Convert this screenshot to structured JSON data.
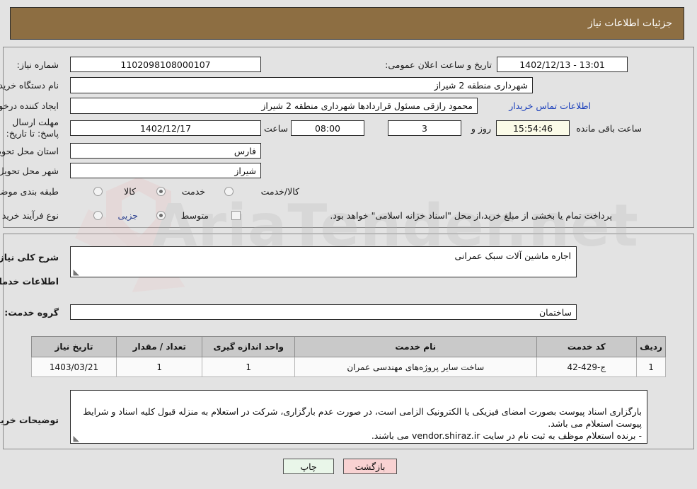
{
  "header": {
    "title": "جزئیات اطلاعات نیاز"
  },
  "colors": {
    "header_bg": "#8d6e42",
    "page_bg": "#e3e3e3",
    "link": "#1b3fbb",
    "timer_bg": "#fbfbe8",
    "table_header_bg": "#c9c9c9",
    "print_button_bg": "#e9f6e9",
    "back_button_bg": "#f8d2d2"
  },
  "form": {
    "need_number_label": "شماره نیاز:",
    "need_number_value": "1102098108000107",
    "buyer_org_label": "نام دستگاه خریدار:",
    "buyer_org_value": "شهرداری منطقه 2 شیراز",
    "requester_label": "ایجاد کننده درخواست:",
    "requester_value": "محمود رازقی مسئول قراردادها شهرداری منطقه 2 شیراز",
    "public_announce_label": "تاریخ و ساعت اعلان عمومی:",
    "public_announce_value": "13:01 - 1402/12/13",
    "buyer_contact_link": "اطلاعات تماس خریدار",
    "deadline_label": "مهلت ارسال پاسخ: تا تاریخ:",
    "deadline_date": "1402/12/17",
    "deadline_hour_label": "ساعت",
    "deadline_hour_value": "08:00",
    "days_value": "3",
    "days_unit_label": "روز و",
    "countdown_value": "15:54:46",
    "countdown_suffix_label": "ساعت باقی مانده",
    "province_label": "استان محل تحویل:",
    "province_value": "فارس",
    "city_label": "شهر محل تحویل:",
    "city_value": "شیراز",
    "category_label": "طبقه بندی موضوعی:",
    "category_options": [
      {
        "label": "کالا",
        "selected": false
      },
      {
        "label": "خدمت",
        "selected": true
      },
      {
        "label": "کالا/خدمت",
        "selected": false
      }
    ],
    "purchase_type_label": "نوع فرآیند خرید :",
    "purchase_type_options": [
      {
        "label": "جزیی",
        "selected": false
      },
      {
        "label": "متوسط",
        "selected": true
      }
    ],
    "treasury_checkbox_checked": false,
    "treasury_text": "پرداخت تمام یا بخشی از مبلغ خرید،از محل \"اسناد خزانه اسلامی\" خواهد بود."
  },
  "description": {
    "general_need_label": "شرح کلی نیاز:",
    "general_need_value": "اجاره ماشین آلات سبک عمرانی",
    "services_info_heading": "اطلاعات خدمات مورد نیاز",
    "service_group_label": "گروه خدمت:",
    "service_group_value": "ساختمان"
  },
  "table": {
    "columns": [
      "ردیف",
      "کد خدمت",
      "نام خدمت",
      "واحد اندازه گیری",
      "تعداد / مقدار",
      "تاریخ نیاز"
    ],
    "rows": [
      {
        "row": "1",
        "service_code": "ج-429-42",
        "service_name": "ساخت سایر پروژه‌های مهندسی عمران",
        "unit": "1",
        "quantity": "1",
        "need_date": "1403/03/21"
      }
    ]
  },
  "buyer_notes": {
    "label": "توضیحات خریدار:",
    "value": "بارگزاری اسناد پیوست بصورت امضای فیزیکی یا الکترونیک الزامی است، در صورت عدم بارگزاری، شرکت در استعلام به منزله قبول کلیه اسناد و شرایط پیوست استعلام می باشد.\n- برنده استعلام موظف به ثبت نام در سایت vendor.shiraz.ir می باشند."
  },
  "buttons": {
    "print": "چاپ",
    "back": "بازگشت"
  },
  "watermark": {
    "text": "AriaTender.net"
  }
}
